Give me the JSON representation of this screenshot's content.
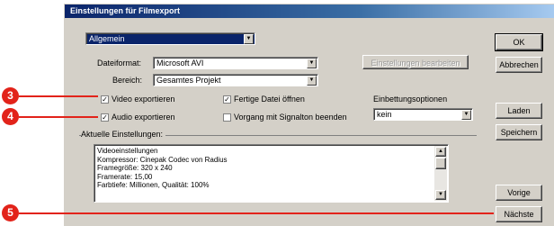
{
  "window": {
    "title": "Einstellungen für Filmexport"
  },
  "top_dropdown": {
    "value": "Allgemein"
  },
  "file_format": {
    "label": "Dateiformat:",
    "value": "Microsoft AVI"
  },
  "range": {
    "label": "Bereich:",
    "value": "Gesamtes Projekt"
  },
  "settings_button": {
    "label": "Einstellungen bearbeiten"
  },
  "checkboxes": {
    "export_video": {
      "label": "Video exportieren",
      "checked": true,
      "mark": "✓"
    },
    "export_audio": {
      "label": "Audio exportieren",
      "checked": true,
      "mark": "✓"
    },
    "open_file": {
      "label": "Fertige Datei öffnen",
      "checked": true,
      "mark": "✓"
    },
    "beep": {
      "label": "Vorgang mit Signalton beenden",
      "checked": false,
      "mark": ""
    }
  },
  "embed_options": {
    "label": "Einbettungsoptionen",
    "value": "kein"
  },
  "current_settings": {
    "label": "Aktuelle Einstellungen:",
    "text": "Videoeinstellungen\nKompressor: Cinepak Codec von Radius\nFramegröße: 320 x 240\nFramerate: 15,00\nFarbtiefe: Millionen, Qualität: 100%"
  },
  "buttons": {
    "ok": "OK",
    "cancel": "Abbrechen",
    "load": "Laden",
    "save": "Speichern",
    "prev": "Vorige",
    "next": "Nächste"
  },
  "markers": [
    "3",
    "4",
    "5"
  ],
  "colors": {
    "marker": "#e2231a",
    "titlebar": "#0a246a",
    "face": "#d4d0c8"
  },
  "icons": {
    "dropdown": "▼",
    "scroll_up": "▲",
    "scroll_down": "▼"
  }
}
